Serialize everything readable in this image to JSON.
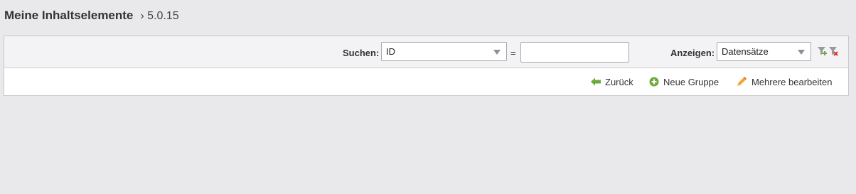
{
  "header": {
    "title": "Meine Inhaltselemente",
    "version": "› 5.0.15"
  },
  "filter": {
    "search_label": "Suchen:",
    "search_field_value": "ID",
    "operator": "=",
    "search_value": "",
    "show_label": "Anzeigen:",
    "show_value": "Datensätze"
  },
  "actions": {
    "back_label": "Zurück",
    "new_group_label": "Neue Gruppe",
    "edit_multiple_label": "Mehrere bearbeiten"
  },
  "icons": {
    "add_filter": "filter-add-icon",
    "remove_filter": "filter-remove-icon",
    "back": "arrow-left-icon",
    "new_group": "plus-circle-icon",
    "edit": "pencil-icon"
  },
  "colors": {
    "green": "#6aaa3c",
    "red": "#d9312b",
    "pencil": "#f0a830"
  }
}
